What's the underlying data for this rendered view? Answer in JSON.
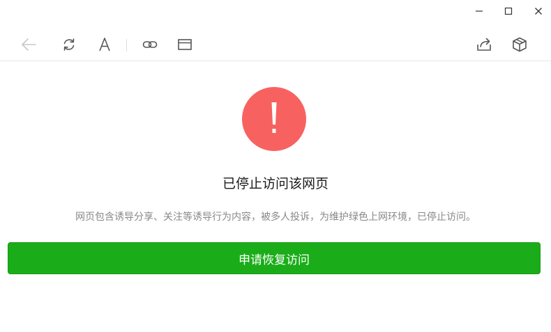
{
  "window_controls": {
    "minimize_icon": "minimize-icon",
    "maximize_icon": "maximize-icon",
    "close_icon": "close-icon"
  },
  "toolbar": {
    "icons": [
      "back-arrow-icon",
      "refresh-icon",
      "font-size-icon",
      "link-icon",
      "window-icon",
      "share-icon",
      "cube-icon"
    ],
    "font_icon_glyph": "A"
  },
  "main": {
    "alert_icon": "exclamation-icon",
    "alert_color": "#f76260",
    "title": "已停止访问该网页",
    "description": "网页包含诱导分享、关注等诱导行为内容，被多人投诉，为维护绿色上网环境，已停止访问。",
    "restore_button_label": "申请恢复访问",
    "button_color": "#1aad19"
  }
}
